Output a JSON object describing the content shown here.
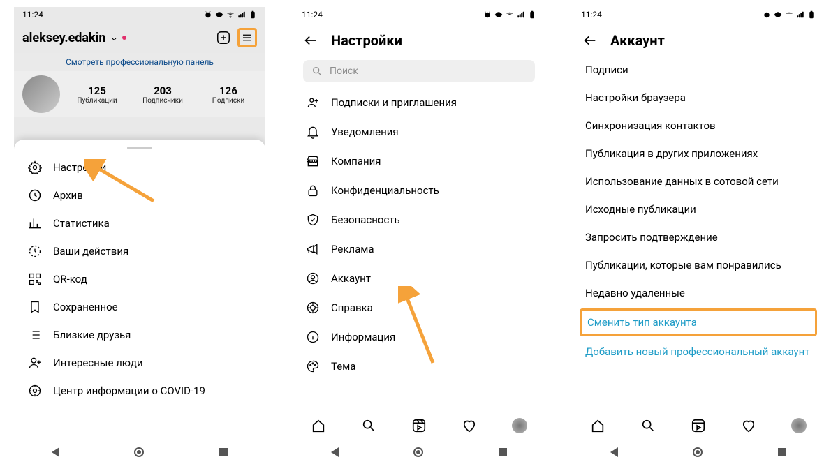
{
  "status": {
    "time": "11:24"
  },
  "screen1": {
    "username": "aleksey.edakin",
    "banner": "Смотреть профессиональную панель",
    "stats": {
      "posts_n": "125",
      "posts_l": "Публикации",
      "followers_n": "203",
      "followers_l": "Подписчики",
      "following_n": "126",
      "following_l": "Подписки"
    },
    "menu": {
      "settings": "Настройки",
      "archive": "Архив",
      "stats": "Статистика",
      "activity": "Ваши действия",
      "qr": "QR-код",
      "saved": "Сохраненное",
      "close_friends": "Близкие друзья",
      "discover": "Интересные люди",
      "covid": "Центр информации о COVID-19"
    }
  },
  "screen2": {
    "title": "Настройки",
    "search_placeholder": "Поиск",
    "items": {
      "invite": "Подписки и приглашения",
      "notifications": "Уведомления",
      "business": "Компания",
      "privacy": "Конфиденциальность",
      "security": "Безопасность",
      "ads": "Реклама",
      "account": "Аккаунт",
      "help": "Справка",
      "about": "Информация",
      "theme": "Тема"
    }
  },
  "screen3": {
    "title": "Аккаунт",
    "items": {
      "captions": "Подписи",
      "browser": "Настройки браузера",
      "contacts": "Синхронизация контактов",
      "share": "Публикация в других приложениях",
      "cellular": "Использование данных в сотовой сети",
      "original": "Исходные публикации",
      "verify": "Запросить подтверждение",
      "liked": "Публикации, которые вам понравились",
      "deleted": "Недавно удаленные",
      "switch": "Сменить тип аккаунта",
      "add_pro": "Добавить новый профессиональный аккаунт"
    }
  }
}
